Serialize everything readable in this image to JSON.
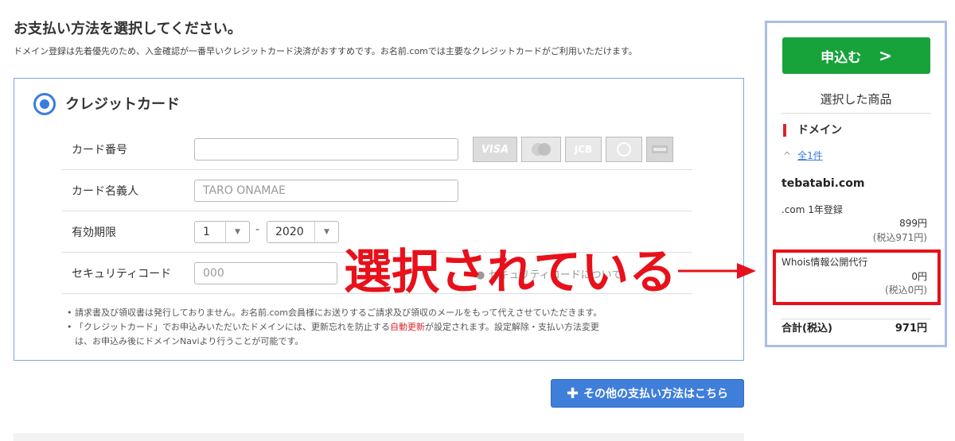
{
  "header": {
    "title": "お支払い方法を選択してください。",
    "subtitle": "ドメイン登録は先着優先のため、入金確認が一番早いクレジットカード決済がおすすめです。お名前.comでは主要なクレジットカードがご利用いただけます。"
  },
  "payment": {
    "method_label": "クレジットカード",
    "selected": true,
    "card_number_label": "カード番号",
    "card_number_value": "",
    "card_brands": [
      "VISA",
      "MasterCard",
      "JCB",
      "Diners Club",
      "AMERICAN EXPRESS"
    ],
    "card_holder_label": "カード名義人",
    "card_holder_placeholder": "TARO ONAMAE",
    "expiry_label": "有効期限",
    "expiry_month": "1",
    "expiry_separator": "-",
    "expiry_year": "2020",
    "security_label": "セキュリティコード",
    "security_placeholder": "000",
    "security_link": "セキュリティコードについて",
    "notes": [
      "請求書及び領収書は発行しておりません。お名前.com会員様にお送りするご請求及び領収のメールをもって代えさせていただきます。",
      "「クレジットカード」でお申込みいただいたドメインには、更新忘れを防止する",
      "自動更新",
      "が設定されます。設定解除・支払い方法変更",
      "は、お申込み後にドメインNaviより行うことが可能です。"
    ],
    "other_methods_label": "その他の支払い方法はこちら"
  },
  "sidebar": {
    "apply_label": "申込む",
    "selected_title": "選択した商品",
    "category": "ドメイン",
    "count_label": "全1件",
    "domain": "tebatabi.com",
    "items": [
      {
        "label": ".com 1年登録",
        "price": "899円",
        "tax": "(税込971円)"
      },
      {
        "label": "Whois情報公開代行",
        "price": "0円",
        "tax": "(税込0円)"
      }
    ],
    "total_label": "合計(税込)",
    "total_value": "971円"
  },
  "annotation": {
    "text": "選択されている"
  },
  "colors": {
    "accent_blue": "#3b7ddd",
    "apply_green": "#17a33a",
    "annotation_red": "#e8101a",
    "sidebar_border": "#a9bfe0"
  }
}
